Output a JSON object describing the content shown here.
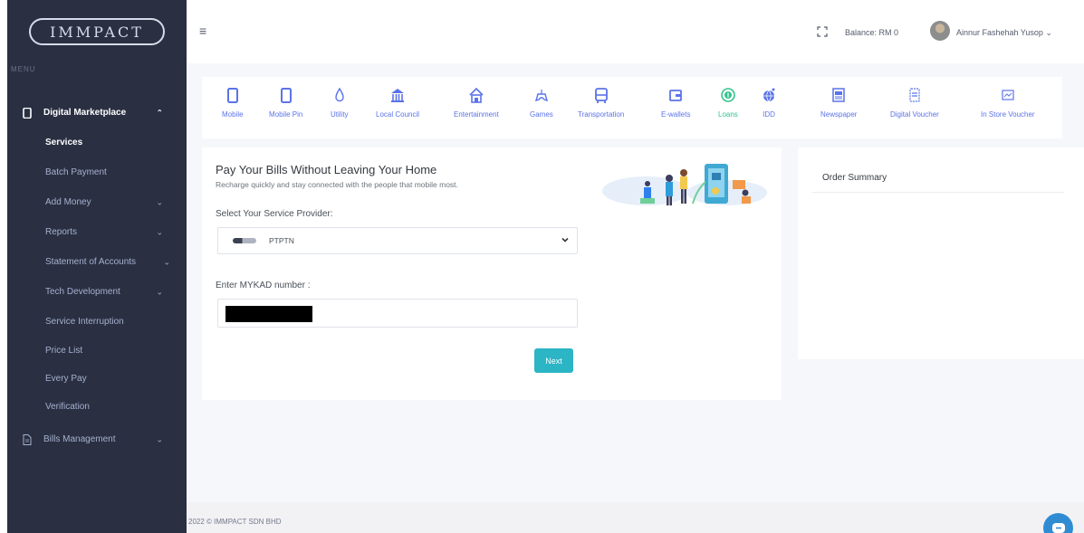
{
  "brand": {
    "logo_text": "IMMPACT"
  },
  "sidebar": {
    "menu_label": "MENU",
    "items": [
      {
        "label": "Digital Marketplace",
        "icon": "phone-icon",
        "chevron": "up"
      },
      {
        "label": "Services"
      },
      {
        "label": "Batch Payment"
      },
      {
        "label": "Add Money",
        "chevron": "down"
      },
      {
        "label": "Reports",
        "chevron": "down"
      },
      {
        "label": "Statement of Accounts",
        "chevron": "down"
      },
      {
        "label": "Tech Development",
        "chevron": "down"
      },
      {
        "label": "Service Interruption"
      },
      {
        "label": "Price List"
      },
      {
        "label": "Every Pay"
      },
      {
        "label": "Verification"
      },
      {
        "label": "Bills Management",
        "icon": "document-icon",
        "chevron": "down"
      }
    ]
  },
  "header": {
    "balance": "Balance: RM 0",
    "user_name": "Ainnur Fashehah Yusop"
  },
  "categories": [
    {
      "label": "Mobile",
      "icon": "mobile-icon"
    },
    {
      "label": "Mobile Pin",
      "icon": "mobile-pin-icon"
    },
    {
      "label": "Utility",
      "icon": "water-drop-icon"
    },
    {
      "label": "Local Council",
      "icon": "bank-icon"
    },
    {
      "label": "Entertainment",
      "icon": "house-icon"
    },
    {
      "label": "Games",
      "icon": "gamepad-icon"
    },
    {
      "label": "Transportation",
      "icon": "bus-icon"
    },
    {
      "label": "E-wallets",
      "icon": "wallet-icon"
    },
    {
      "label": "Loans",
      "icon": "coin-icon",
      "active": true
    },
    {
      "label": "IDD",
      "icon": "globe-icon"
    },
    {
      "label": "Newspaper",
      "icon": "newspaper-icon"
    },
    {
      "label": "Digital Voucher",
      "icon": "voucher-icon"
    },
    {
      "label": "In Store Voucher",
      "icon": "ticket-icon"
    }
  ],
  "form": {
    "title": "Pay Your Bills Without Leaving Your Home",
    "subtitle": "Recharge quickly and stay connected with the people that mobile most.",
    "provider_label": "Select Your Service Provider:",
    "provider_value": "PTPTN",
    "mykad_label": "Enter MYKAD number :",
    "next_label": "Next"
  },
  "order_summary": {
    "title": "Order Summary"
  },
  "footer": {
    "text": "2022 © IMMPACT SDN BHD"
  },
  "colors": {
    "sidebar_bg": "#2a3042",
    "accent": "#5b73e8",
    "active": "#34c38f",
    "button": "#2bb5c5",
    "chat": "#2f8cd3"
  }
}
